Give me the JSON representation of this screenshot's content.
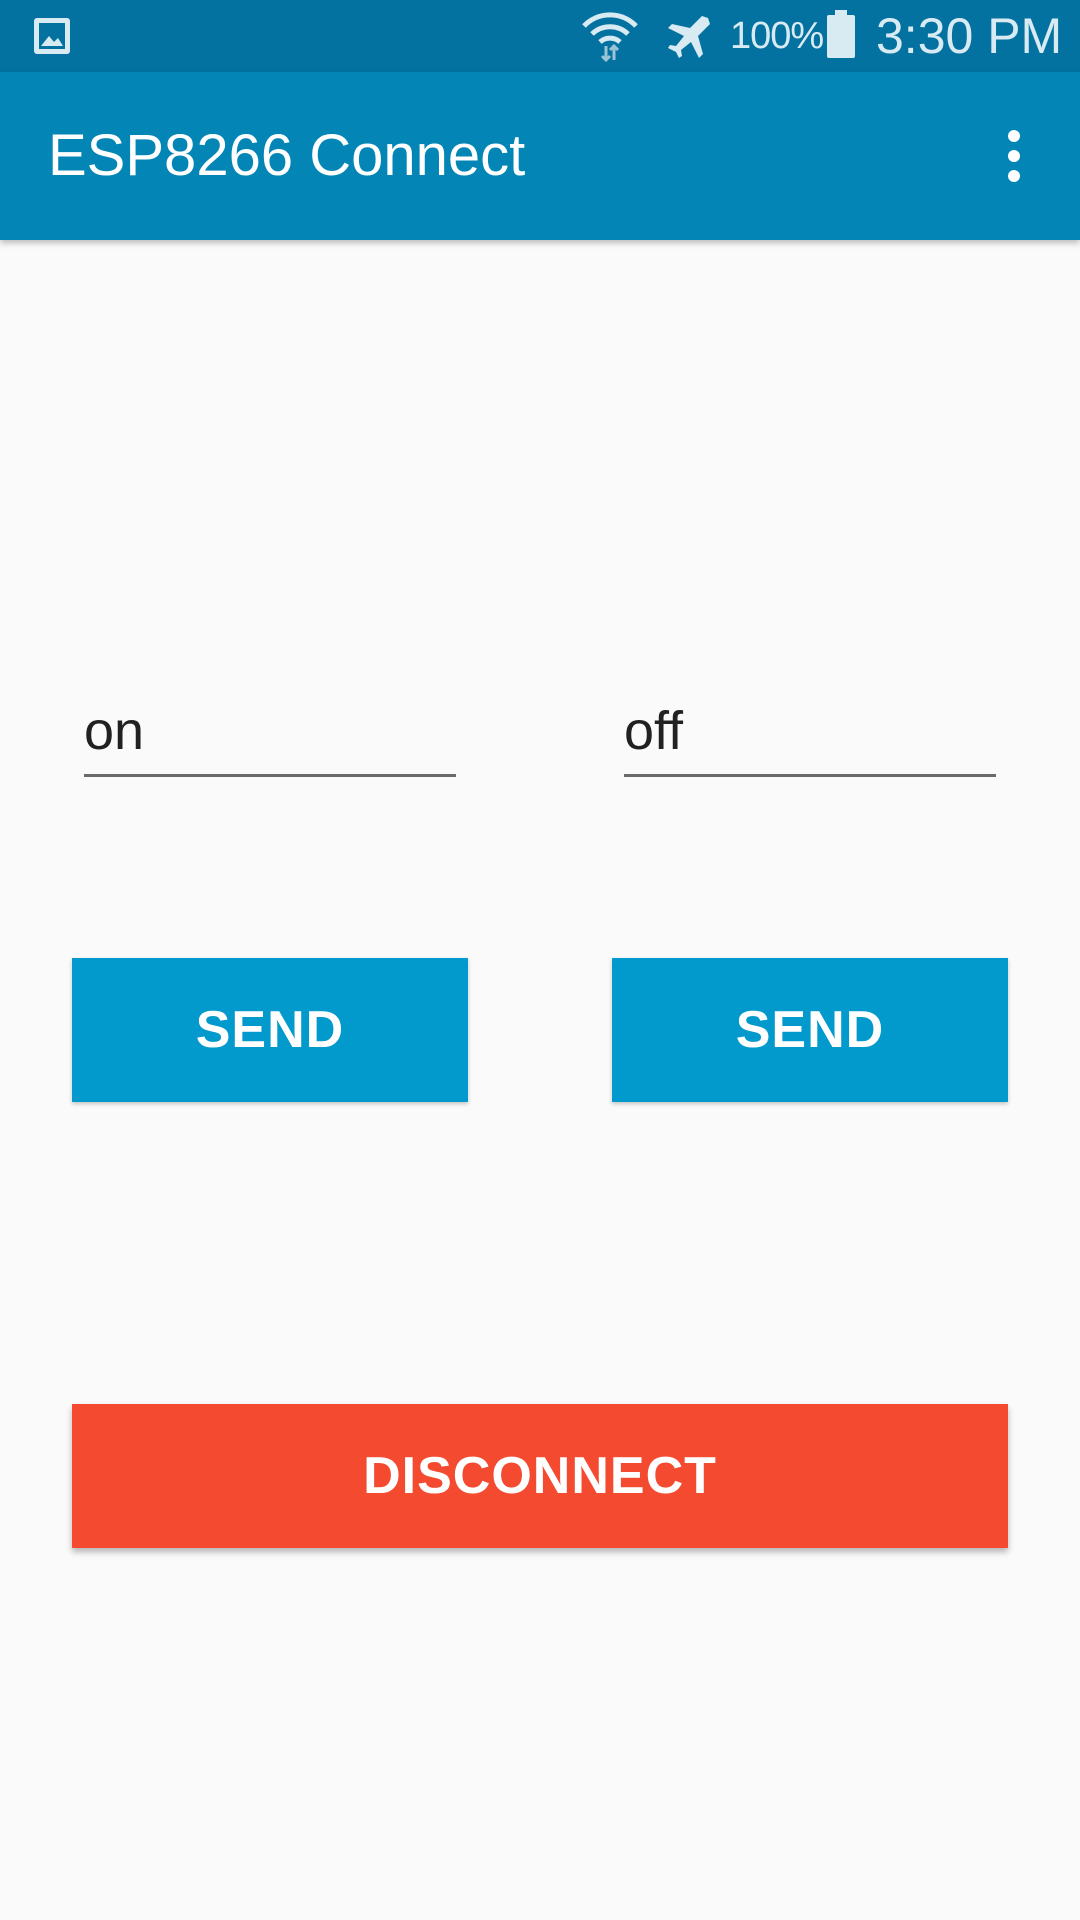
{
  "status_bar": {
    "notification_icon": "image-icon",
    "wifi_icon": "wifi-icon",
    "airplane_icon": "airplane-icon",
    "battery_icon": "battery-icon",
    "battery_percent": "100%",
    "time": "3:30 PM"
  },
  "app_bar": {
    "title": "ESP8266 Connect",
    "menu_icon": "more-vert-icon"
  },
  "fields": {
    "left_value": "on",
    "right_value": "off"
  },
  "buttons": {
    "send_left": "SEND",
    "send_right": "SEND",
    "disconnect": "DISCONNECT"
  },
  "colors": {
    "status_bar": "#0372a0",
    "app_bar": "#0386b6",
    "send_button": "#0299cc",
    "disconnect_button": "#f44b30",
    "background": "#fafafa"
  }
}
